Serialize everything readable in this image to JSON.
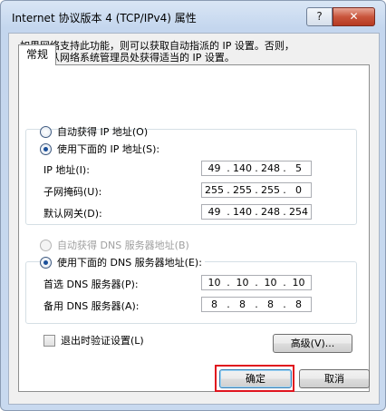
{
  "window": {
    "title": "Internet 协议版本 4 (TCP/IPv4) 属性",
    "help_label": "?",
    "close_label": "✕"
  },
  "tab": {
    "label": "常规"
  },
  "description": {
    "line1": "如果网络支持此功能，则可以获取自动指派的 IP 设置。否则，",
    "line2": "您需要从网络系统管理员处获得适当的 IP 设置。"
  },
  "ip": {
    "auto_label": "自动获得 IP 地址(O)",
    "manual_label": "使用下面的 IP 地址(S):",
    "selected": "manual",
    "fields": [
      {
        "label": "IP 地址(I):",
        "segments": [
          "49",
          "140",
          "248",
          "5"
        ]
      },
      {
        "label": "子网掩码(U):",
        "segments": [
          "255",
          "255",
          "255",
          "0"
        ]
      },
      {
        "label": "默认网关(D):",
        "segments": [
          "49",
          "140",
          "248",
          "254"
        ]
      }
    ]
  },
  "dns": {
    "auto_label": "自动获得 DNS 服务器地址(B)",
    "manual_label": "使用下面的 DNS 服务器地址(E):",
    "selected": "manual",
    "fields": [
      {
        "label": "首选 DNS 服务器(P):",
        "segments": [
          "10",
          "10",
          "10",
          "10"
        ]
      },
      {
        "label": "备用 DNS 服务器(A):",
        "segments": [
          "8",
          "8",
          "8",
          "8"
        ]
      }
    ]
  },
  "validate": {
    "label": "退出时验证设置(L)",
    "checked": false
  },
  "buttons": {
    "advanced": "高级(V)...",
    "ok": "确定",
    "cancel": "取消"
  },
  "colors": {
    "highlight": "#e0141e",
    "title_bar": "#c4d6ee"
  }
}
